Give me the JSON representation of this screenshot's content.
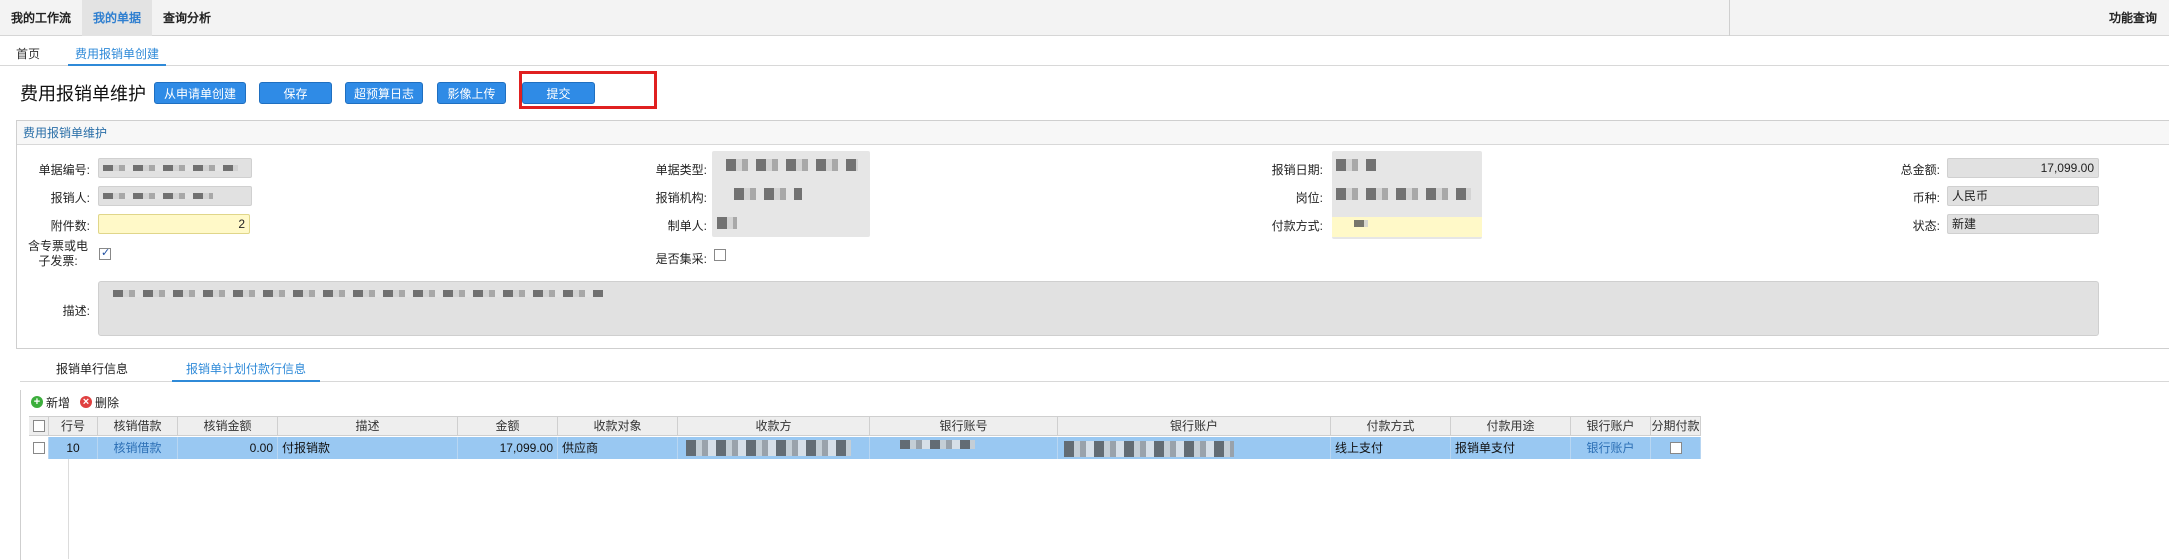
{
  "topbar": {
    "menus": [
      "我的工作流",
      "我的单据",
      "查询分析"
    ],
    "right_label": "功能查询"
  },
  "tabs": {
    "home": "首页",
    "active": "费用报销单创建"
  },
  "page": {
    "title": "费用报销单维护",
    "buttons": {
      "create_from_request": "从申请单创建",
      "save": "保存",
      "over_budget_log": "超预算日志",
      "image_upload": "影像上传",
      "submit": "提交"
    }
  },
  "form": {
    "panel_title": "费用报销单维护",
    "labels": {
      "doc_no": "单据编号:",
      "reimburser": "报销人:",
      "attachments": "附件数:",
      "special_invoice": "含专票或电子发票:",
      "description": "描述:",
      "doc_type": "单据类型:",
      "org": "报销机构:",
      "creator": "制单人:",
      "is_centralized": "是否集采:",
      "date": "报销日期:",
      "position": "岗位:",
      "pay_method": "付款方式:",
      "total": "总金额:",
      "currency": "币种:",
      "status": "状态:"
    },
    "values": {
      "attachments": "2",
      "total": "17,099.00",
      "currency": "人民币",
      "status": "新建",
      "special_invoice_checked": true,
      "is_centralized_checked": false
    }
  },
  "bottom_tabs": {
    "line_info": "报销单行信息",
    "plan_payment": "报销单计划付款行信息"
  },
  "grid": {
    "toolbar": {
      "add": "新增",
      "delete": "删除"
    },
    "columns": [
      "行号",
      "核销借款",
      "核销金额",
      "描述",
      "金额",
      "收款对象",
      "收款方",
      "银行账号",
      "银行账户",
      "付款方式",
      "付款用途",
      "银行账户",
      "分期付款"
    ],
    "rows": [
      {
        "line_no": "10",
        "writeoff_loan": "核销借款",
        "writeoff_amount": "0.00",
        "desc": "付报销款",
        "amount": "17,099.00",
        "payee_type": "供应商",
        "pay_method": "线上支付",
        "pay_purpose": "报销单支付",
        "bank_account_link": "银行账户"
      }
    ]
  }
}
